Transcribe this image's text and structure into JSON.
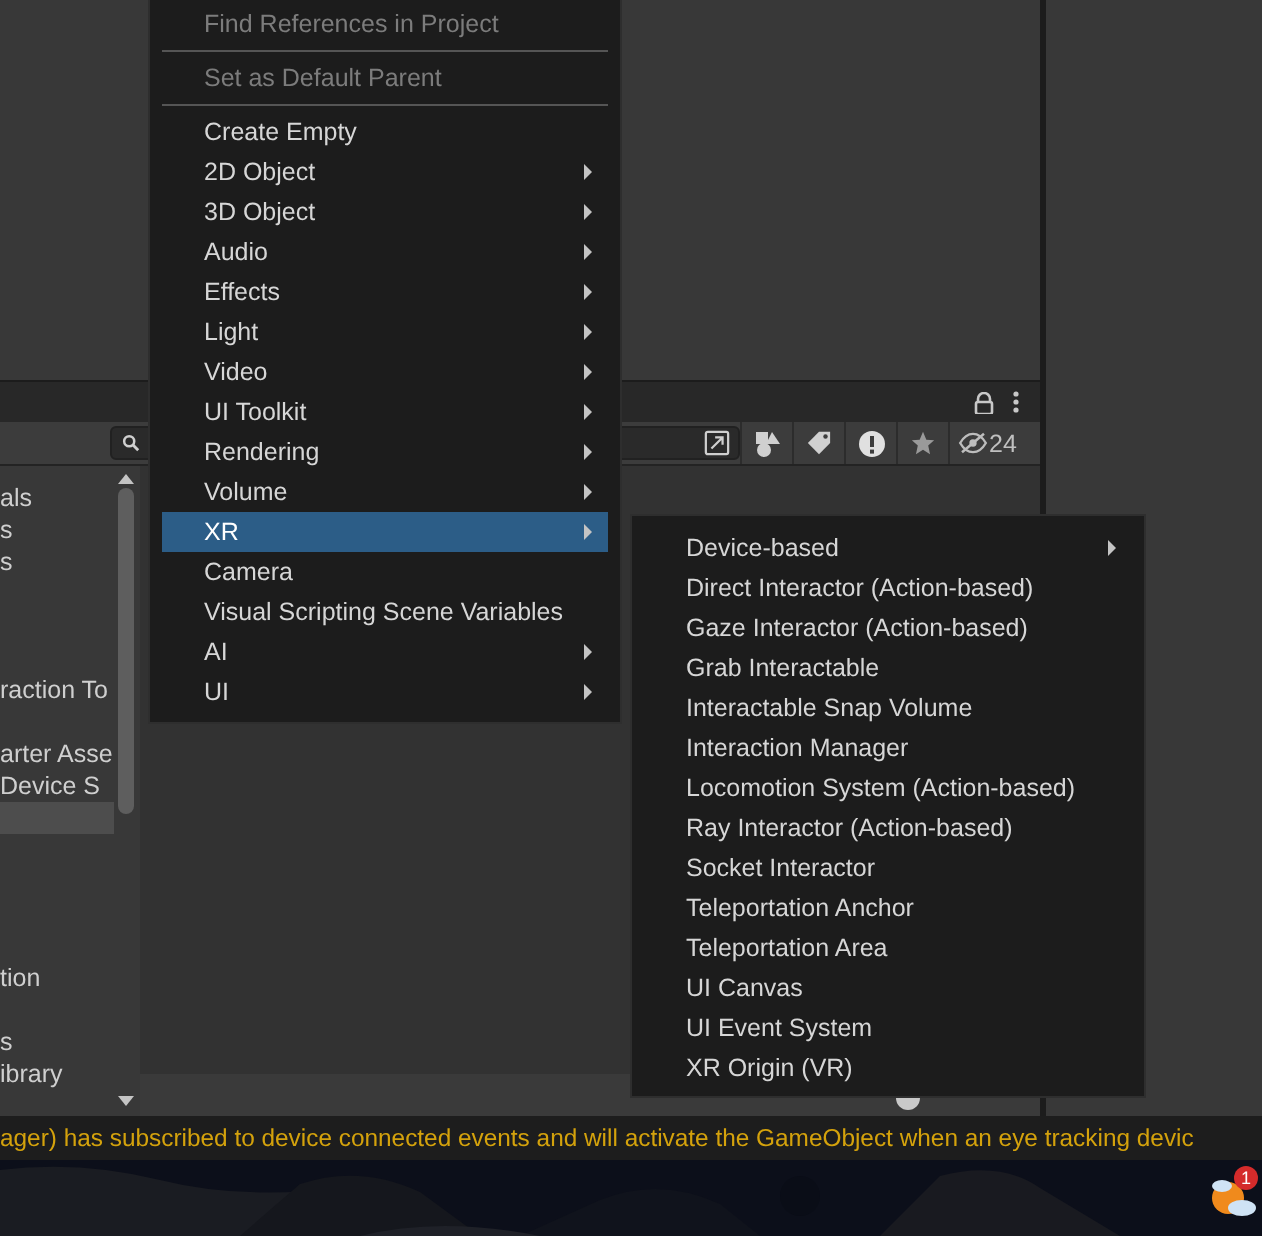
{
  "panel": {
    "list_rows": [
      {
        "label": "als",
        "selected": false
      },
      {
        "label": "s",
        "selected": false
      },
      {
        "label": "s",
        "selected": false
      },
      {
        "label": "raction To",
        "selected": false
      },
      {
        "label": "arter Asse",
        "selected": false
      },
      {
        "label": "Device S",
        "selected": false
      },
      {
        "selected": true
      },
      {
        "label": "tion",
        "selected": false
      },
      {
        "label": "s",
        "selected": false
      },
      {
        "label": "ibrary",
        "selected": false
      }
    ],
    "hidden_count": "24"
  },
  "context_menu": {
    "items": [
      {
        "kind": "item",
        "label": "Find References in Project",
        "disabled": true,
        "submenu": false,
        "selected": false
      },
      {
        "kind": "separator"
      },
      {
        "kind": "item",
        "label": "Set as Default Parent",
        "disabled": true,
        "submenu": false,
        "selected": false
      },
      {
        "kind": "separator"
      },
      {
        "kind": "item",
        "label": "Create Empty",
        "disabled": false,
        "submenu": false,
        "selected": false
      },
      {
        "kind": "item",
        "label": "2D Object",
        "disabled": false,
        "submenu": true,
        "selected": false
      },
      {
        "kind": "item",
        "label": "3D Object",
        "disabled": false,
        "submenu": true,
        "selected": false
      },
      {
        "kind": "item",
        "label": "Audio",
        "disabled": false,
        "submenu": true,
        "selected": false
      },
      {
        "kind": "item",
        "label": "Effects",
        "disabled": false,
        "submenu": true,
        "selected": false
      },
      {
        "kind": "item",
        "label": "Light",
        "disabled": false,
        "submenu": true,
        "selected": false
      },
      {
        "kind": "item",
        "label": "Video",
        "disabled": false,
        "submenu": true,
        "selected": false
      },
      {
        "kind": "item",
        "label": "UI Toolkit",
        "disabled": false,
        "submenu": true,
        "selected": false
      },
      {
        "kind": "item",
        "label": "Rendering",
        "disabled": false,
        "submenu": true,
        "selected": false
      },
      {
        "kind": "item",
        "label": "Volume",
        "disabled": false,
        "submenu": true,
        "selected": false
      },
      {
        "kind": "item",
        "label": "XR",
        "disabled": false,
        "submenu": true,
        "selected": true
      },
      {
        "kind": "item",
        "label": "Camera",
        "disabled": false,
        "submenu": false,
        "selected": false
      },
      {
        "kind": "item",
        "label": "Visual Scripting Scene Variables",
        "disabled": false,
        "submenu": false,
        "selected": false
      },
      {
        "kind": "item",
        "label": "AI",
        "disabled": false,
        "submenu": true,
        "selected": false
      },
      {
        "kind": "item",
        "label": "UI",
        "disabled": false,
        "submenu": true,
        "selected": false
      }
    ]
  },
  "submenu": {
    "items": [
      {
        "label": "Device-based",
        "submenu": true
      },
      {
        "label": "Direct Interactor (Action-based)",
        "submenu": false
      },
      {
        "label": "Gaze Interactor (Action-based)",
        "submenu": false
      },
      {
        "label": "Grab Interactable",
        "submenu": false
      },
      {
        "label": "Interactable Snap Volume",
        "submenu": false
      },
      {
        "label": "Interaction Manager",
        "submenu": false
      },
      {
        "label": "Locomotion System (Action-based)",
        "submenu": false
      },
      {
        "label": "Ray Interactor (Action-based)",
        "submenu": false
      },
      {
        "label": "Socket Interactor",
        "submenu": false
      },
      {
        "label": "Teleportation Anchor",
        "submenu": false
      },
      {
        "label": "Teleportation Area",
        "submenu": false
      },
      {
        "label": "UI Canvas",
        "submenu": false
      },
      {
        "label": "UI Event System",
        "submenu": false
      },
      {
        "label": "XR Origin (VR)",
        "submenu": false
      }
    ]
  },
  "status_bar": {
    "message": "ager) has subscribed to device connected events and will activate the GameObject when an eye tracking devic"
  },
  "taskbar": {
    "weather_badge": "1"
  }
}
